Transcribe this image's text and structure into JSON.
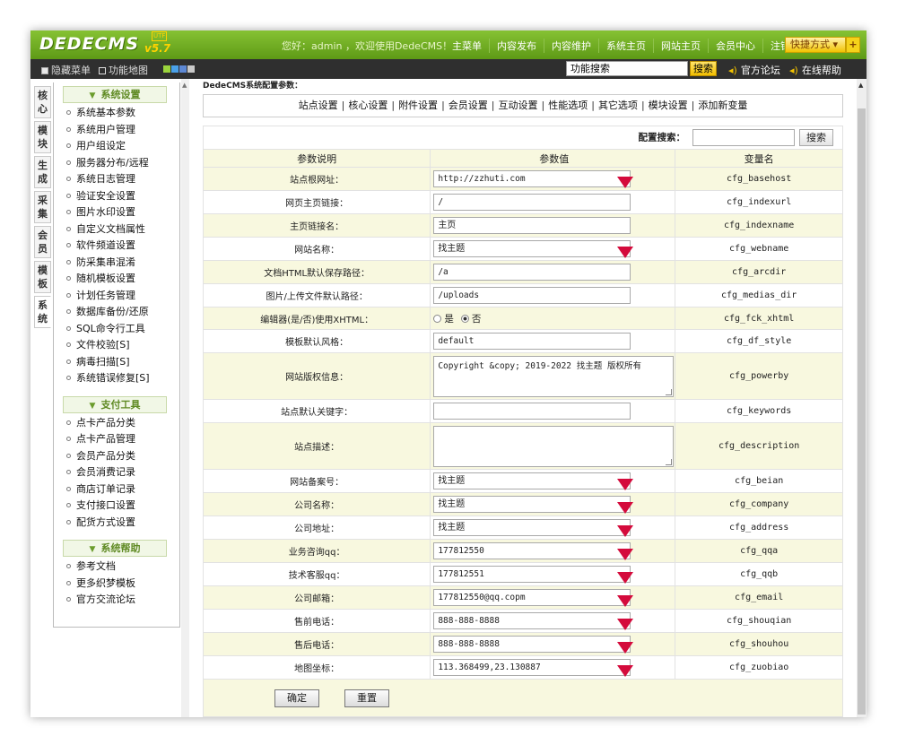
{
  "header": {
    "logo_text": "DEDECMS",
    "logo_version": "v5.7",
    "logo_badge": "UTF",
    "welcome": "您好：admin ，欢迎使用DedeCMS！",
    "nav": [
      "主菜单",
      "内容发布",
      "内容维护",
      "系统主页",
      "网站主页",
      "会员中心",
      "注销"
    ],
    "quick_label": "快捷方式 ▾",
    "quick_plus": "+"
  },
  "subbar": {
    "hide_menu": "隐藏菜单",
    "func_map": "功能地图",
    "search_value": "功能搜索",
    "search_button": "搜索",
    "forum": "官方论坛",
    "help": "在线帮助"
  },
  "left_tabs": [
    "核心",
    "模块",
    "生成",
    "采集",
    "会员",
    "模板",
    "系统"
  ],
  "left_menu": {
    "sections": [
      {
        "title": "系统设置",
        "items": [
          "系统基本参数",
          "系统用户管理",
          "用户组设定",
          "服务器分布/远程",
          "系统日志管理",
          "验证安全设置",
          "图片水印设置",
          "自定义文档属性",
          "软件频道设置",
          "防采集串混淆",
          "随机模板设置",
          "计划任务管理",
          "数据库备份/还原",
          "SQL命令行工具",
          "文件校验[S]",
          "病毒扫描[S]",
          "系统错误修复[S]"
        ]
      },
      {
        "title": "支付工具",
        "items": [
          "点卡产品分类",
          "点卡产品管理",
          "会员产品分类",
          "会员消费记录",
          "商店订单记录",
          "支付接口设置",
          "配货方式设置"
        ]
      },
      {
        "title": "系统帮助",
        "items": [
          "参考文档",
          "更多织梦模板",
          "官方交流论坛"
        ]
      }
    ]
  },
  "content": {
    "breadcrumb": "DedeCMS系统配置参数：",
    "tabs": [
      "站点设置",
      "核心设置",
      "附件设置",
      "会员设置",
      "互动设置",
      "性能选项",
      "其它选项",
      "模块设置",
      "添加新变量"
    ],
    "config_search_label": "配置搜索：",
    "config_search_button": "搜索",
    "headers": [
      "参数说明",
      "参数值",
      "变量名"
    ],
    "rows": [
      {
        "label": "站点根网址：",
        "value": "http://zzhuti.com",
        "var": "cfg_basehost",
        "kind": "input",
        "marker": true
      },
      {
        "label": "网页主页链接：",
        "value": "/",
        "var": "cfg_indexurl",
        "kind": "input",
        "marker": false
      },
      {
        "label": "主页链接名：",
        "value": "主页",
        "var": "cfg_indexname",
        "kind": "input",
        "marker": false
      },
      {
        "label": "网站名称：",
        "value": "找主题",
        "var": "cfg_webname",
        "kind": "input",
        "marker": true
      },
      {
        "label": "文档HTML默认保存路径：",
        "value": "/a",
        "var": "cfg_arcdir",
        "kind": "input",
        "marker": false
      },
      {
        "label": "图片/上传文件默认路径：",
        "value": "/uploads",
        "var": "cfg_medias_dir",
        "kind": "input",
        "marker": false
      },
      {
        "label": "编辑器(是/否)使用XHTML：",
        "value": "",
        "var": "cfg_fck_xhtml",
        "kind": "radio",
        "marker": false,
        "options": [
          "是",
          "否"
        ],
        "selected": 1
      },
      {
        "label": "模板默认风格：",
        "value": "default",
        "var": "cfg_df_style",
        "kind": "input",
        "marker": false
      },
      {
        "label": "网站版权信息：",
        "value": "Copyright &copy; 2019-2022 找主题 版权所有",
        "var": "cfg_powerby",
        "kind": "textarea",
        "marker": false
      },
      {
        "label": "站点默认关键字：",
        "value": "",
        "var": "cfg_keywords",
        "kind": "input",
        "marker": false
      },
      {
        "label": "站点描述：",
        "value": "",
        "var": "cfg_description",
        "kind": "textarea",
        "marker": false
      },
      {
        "label": "网站备案号：",
        "value": "找主题",
        "var": "cfg_beian",
        "kind": "input",
        "marker": true
      },
      {
        "label": "公司名称：",
        "value": "找主题",
        "var": "cfg_company",
        "kind": "input",
        "marker": true
      },
      {
        "label": "公司地址：",
        "value": "找主题",
        "var": "cfg_address",
        "kind": "input",
        "marker": true
      },
      {
        "label": "业务咨询qq：",
        "value": "177812550",
        "var": "cfg_qqa",
        "kind": "input",
        "marker": true
      },
      {
        "label": "技术客服qq：",
        "value": "177812551",
        "var": "cfg_qqb",
        "kind": "input",
        "marker": true
      },
      {
        "label": "公司邮箱：",
        "value": "177812550@qq.copm",
        "var": "cfg_email",
        "kind": "input",
        "marker": true
      },
      {
        "label": "售前电话：",
        "value": "888-888-8888",
        "var": "cfg_shouqian",
        "kind": "input",
        "marker": true
      },
      {
        "label": "售后电话：",
        "value": "888-888-8888",
        "var": "cfg_shouhou",
        "kind": "input",
        "marker": true
      },
      {
        "label": "地图坐标：",
        "value": "113.368499,23.130887",
        "var": "cfg_zuobiao",
        "kind": "input",
        "marker": true
      }
    ],
    "ok_button": "确定",
    "reset_button": "重置"
  },
  "colors": {
    "header_green": "#6ea824",
    "subbar_dark": "#2f2f2f",
    "row_cream": "#f8f8df",
    "marker_red": "#d40b3c",
    "quick_yellow": "#f2c200"
  }
}
